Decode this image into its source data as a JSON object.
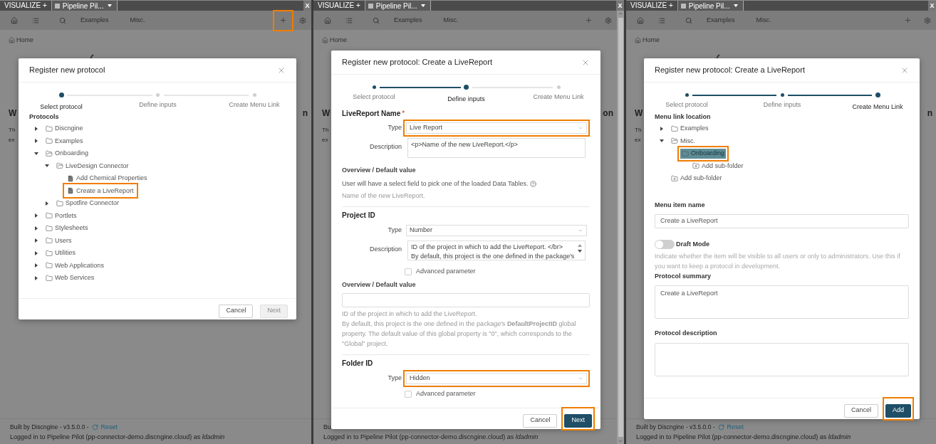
{
  "panels": [
    {
      "app_tab": "VISUALIZE +",
      "doc_tab": "Pipeline Pil...",
      "close": "X",
      "toolbar": {
        "links": [
          "Examples",
          "Misc."
        ],
        "add_highlighted": true
      },
      "breadcrumb": "Home",
      "background": {
        "heading_start": "W",
        "heading_end": "n",
        "text_lines": [
          "Th",
          "ex"
        ]
      },
      "footer": {
        "built": "Built by Discngine - v3.5.0.0 -",
        "reset": "Reset",
        "login": "Logged in to Pipeline Pilot (pp-connector-demo.discngine.cloud) as *ldadmin*"
      },
      "dialog": {
        "kind": "select_protocol",
        "title": "Register new protocol",
        "steps": [
          {
            "label": "Select protocol",
            "active": true
          },
          {
            "label": "Define inputs",
            "active": false,
            "done": false
          },
          {
            "label": "Create Menu Link",
            "active": false,
            "done": false
          }
        ],
        "section_label": "Protocols",
        "tree": [
          {
            "label": "Discngine",
            "kind": "folder",
            "expanded": false,
            "highlighted": false
          },
          {
            "label": "Examples",
            "kind": "folder",
            "expanded": false,
            "highlighted": false
          },
          {
            "label": "Onboarding",
            "kind": "folder",
            "expanded": true,
            "highlighted": false,
            "children": [
              {
                "label": "LiveDesign Connector",
                "kind": "folder",
                "expanded": true,
                "highlighted": false,
                "children": [
                  {
                    "label": "Add Chemical Properties",
                    "kind": "file",
                    "highlighted": false
                  },
                  {
                    "label": "Create a LiveReport",
                    "kind": "file",
                    "highlighted": true
                  }
                ]
              },
              {
                "label": "Spotfire Connector",
                "kind": "folder",
                "expanded": false,
                "highlighted": false
              }
            ]
          },
          {
            "label": "Portlets",
            "kind": "folder",
            "expanded": false,
            "highlighted": false
          },
          {
            "label": "Stylesheets",
            "kind": "folder",
            "expanded": false,
            "highlighted": false
          },
          {
            "label": "Users",
            "kind": "folder",
            "expanded": false,
            "highlighted": false
          },
          {
            "label": "Utilities",
            "kind": "folder",
            "expanded": false,
            "highlighted": false
          },
          {
            "label": "Web Applications",
            "kind": "folder",
            "expanded": false,
            "highlighted": false
          },
          {
            "label": "Web Services",
            "kind": "folder",
            "expanded": false,
            "highlighted": false
          }
        ],
        "buttons": [
          {
            "label": "Cancel",
            "kind": "secondary",
            "disabled": false,
            "highlighted": false
          },
          {
            "label": "Next",
            "kind": "primary",
            "disabled": true,
            "highlighted": false
          }
        ]
      }
    },
    {
      "app_tab": "VISUALIZE +",
      "doc_tab": "Pipeline Pil...",
      "close": "X",
      "toolbar": {
        "links": [
          "Examples",
          "Misc."
        ],
        "add_highlighted": false
      },
      "breadcrumb": "Home",
      "background": {
        "heading_start": "W",
        "heading_end": "on",
        "text_lines": [
          "Th",
          "ex"
        ]
      },
      "footer": {
        "built": "Bu",
        "login": "Logged in to Pipeline Pilot (pp-connector-demo.discngine.cloud) as *ldadmin*"
      },
      "dialog": {
        "kind": "define_inputs",
        "title": "Register new protocol: Create a LiveReport",
        "steps": [
          {
            "label": "Select protocol",
            "active": false,
            "done": true
          },
          {
            "label": "Define inputs",
            "active": true
          },
          {
            "label": "Create Menu Link",
            "active": false,
            "done": false
          }
        ],
        "sections": [
          {
            "title": "LiveReport Name",
            "required_mark": "*",
            "type_label": "Type",
            "type_value": "Live Report",
            "type_highlighted": true,
            "description_label": "Description",
            "description_lines": [
              "<p>Name of the new LiveReport.</p>"
            ],
            "overview": {
              "label": "Overview / Default value",
              "kind": "note",
              "text": "User will have a select field to pick one of the loaded Data Tables."
            },
            "hint_lines": [
              "Name of the new LiveReport."
            ]
          },
          {
            "title": "Project ID",
            "type_label": "Type",
            "type_value": "Number",
            "type_highlighted": false,
            "description_label": "Description",
            "description_lines": [
              "ID of the project in which to add the LiveReport. </br>",
              "By default, this project is the one defined in the package's"
            ],
            "advanced": {
              "label": "Advanced parameter",
              "checked": false
            },
            "overview": {
              "label": "Overview / Default value",
              "kind": "input"
            },
            "hint_lines": [
              "ID of the project in which to add the LiveReport.",
              "By default, this project is the one defined in the package's **DefaultProjectID** global property. The default value of this global property is \"0\", which corresponds to the \"Global\" project."
            ]
          },
          {
            "title": "Folder ID",
            "type_label": "Type",
            "type_value": "Hidden",
            "type_highlighted": true,
            "advanced": {
              "label": "Advanced parameter",
              "checked": false
            }
          }
        ],
        "buttons": [
          {
            "label": "Cancel",
            "kind": "secondary",
            "disabled": false,
            "highlighted": false
          },
          {
            "label": "Next",
            "kind": "primary",
            "disabled": false,
            "highlighted": true
          }
        ]
      }
    },
    {
      "app_tab": "VISUALIZE +",
      "doc_tab": "Pipeline Pil...",
      "close": "X",
      "toolbar": {
        "links": [
          "Examples",
          "Misc."
        ],
        "add_highlighted": false
      },
      "breadcrumb": "Home",
      "background": {
        "heading_start": "W",
        "heading_end": "n",
        "text_lines": [
          "Th",
          "ex"
        ]
      },
      "footer": {
        "built": "Built by Discngine - v3.5.0.0 -",
        "reset": "Reset",
        "login": "Logged in to Pipeline Pilot (pp-connector-demo.discngine.cloud) as *ldadmin*"
      },
      "dialog": {
        "kind": "create_menu_link",
        "title": "Register new protocol: Create a LiveReport",
        "steps": [
          {
            "label": "Select protocol",
            "active": false,
            "done": true
          },
          {
            "label": "Define inputs",
            "active": false,
            "done": true
          },
          {
            "label": "Create Menu Link",
            "active": true
          }
        ],
        "section_label": "Menu link location",
        "tree": [
          {
            "label": "Examples",
            "kind": "folder",
            "expanded": false,
            "selected": false,
            "highlighted": false
          },
          {
            "label": "Misc.",
            "kind": "folder",
            "expanded": true,
            "selected": false,
            "highlighted": false,
            "children": [
              {
                "label": "Onboarding",
                "kind": "folder",
                "selected": true,
                "highlighted": true,
                "children": [
                  {
                    "label": "Add sub-folder",
                    "kind": "add",
                    "selected": false,
                    "highlighted": false
                  }
                ]
              }
            ]
          },
          {
            "label": "Add sub-folder",
            "kind": "add",
            "selected": false,
            "highlighted": false
          }
        ],
        "fields": [
          {
            "kind": "input",
            "label": "Menu item name",
            "value": "Create a LiveReport"
          },
          {
            "kind": "toggle",
            "label": "Draft Mode",
            "on": false,
            "help": "Indicate whether the item will be visible to all users or only to administrators. Use this if you want to keep a protocol in development."
          },
          {
            "kind": "textarea",
            "label": "Protocol summary",
            "value": "Create a LiveReport"
          },
          {
            "kind": "textarea",
            "label": "Protocol description"
          }
        ],
        "buttons": [
          {
            "label": "Cancel",
            "kind": "secondary",
            "disabled": false,
            "highlighted": false
          },
          {
            "label": "Add",
            "kind": "primary",
            "disabled": false,
            "highlighted": true
          }
        ]
      }
    }
  ]
}
